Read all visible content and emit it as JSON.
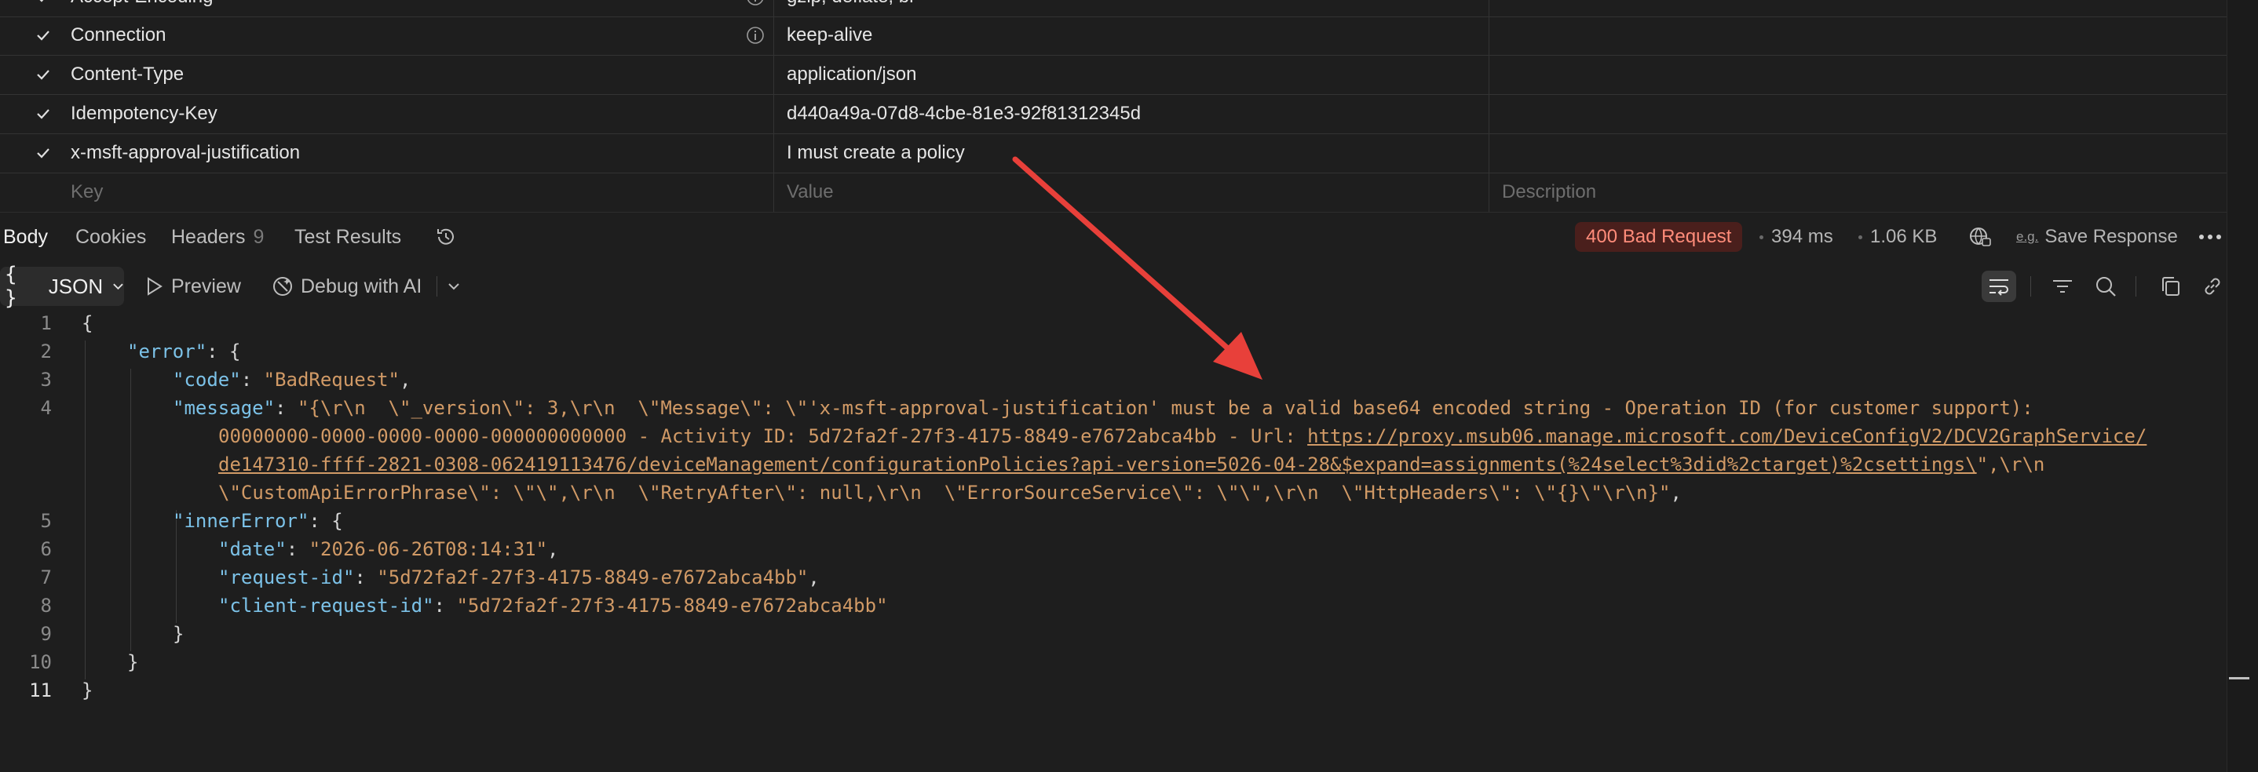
{
  "headers_table": {
    "rows": [
      {
        "key": "Accept-Encoding",
        "value": "gzip, deflate, br",
        "has_info": true
      },
      {
        "key": "Connection",
        "value": "keep-alive",
        "has_info": true
      },
      {
        "key": "Content-Type",
        "value": "application/json",
        "has_info": false
      },
      {
        "key": "Idempotency-Key",
        "value": "d440a49a-07d8-4cbe-81e3-92f81312345d",
        "has_info": false
      },
      {
        "key": "x-msft-approval-justification",
        "value": "I must create a policy",
        "has_info": false
      }
    ],
    "placeholder": {
      "key": "Key",
      "value": "Value",
      "description": "Description"
    }
  },
  "response_tabs": {
    "body": "Body",
    "cookies": "Cookies",
    "headers": "Headers",
    "headers_count": "9",
    "test_results": "Test Results"
  },
  "response_meta": {
    "status": "400 Bad Request",
    "status_color": "#ff8c7a",
    "time": "394 ms",
    "size": "1.06 KB",
    "save_label": "Save Response",
    "save_icon_text": "e.g."
  },
  "toolbar": {
    "format_icon": "{ }",
    "format": "JSON",
    "preview": "Preview",
    "debug": "Debug with AI"
  },
  "code": {
    "line_numbers": [
      "1",
      "2",
      "3",
      "4",
      "",
      "",
      "",
      "5",
      "6",
      "7",
      "8",
      "9",
      "10",
      "11"
    ],
    "l1": "{",
    "l2_key": "\"error\"",
    "l2_rest": ": {",
    "l3_key": "\"code\"",
    "l3_sep": ": ",
    "l3_val": "\"BadRequest\"",
    "l3_end": ",",
    "l4_key": "\"message\"",
    "l4_sep": ": ",
    "l4_val_a": "\"{\\r\\n  \\\"_version\\\": 3,\\r\\n  \\\"Message\\\": \\\"'x-msft-approval-justification' must be a valid base64 encoded string - Operation ID (for customer support):",
    "l4_val_b": "00000000-0000-0000-0000-000000000000 - Activity ID: 5d72fa2f-27f3-4175-8849-e7672abca4bb - Url: ",
    "l4_url_1": "https://proxy.msub06.manage.microsoft.com/DeviceConfigV2/DCV2GraphService/",
    "l4_url_2": "de147310-ffff-2821-0308-062419113476/deviceManagement/configurationPolicies?api-version=5026-04-28&$expand=assignments(%24select%3did%2ctarget)%2csettings\\",
    "l4_val_c": "\",\\r\\n",
    "l4_val_d": "\\\"CustomApiErrorPhrase\\\": \\\"\\\",\\r\\n  \\\"RetryAfter\\\": null,\\r\\n  \\\"ErrorSourceService\\\": \\\"\\\",\\r\\n  \\\"HttpHeaders\\\": \\\"{}\\\"\\r\\n}\"",
    "l4_end": ",",
    "l5_key": "\"innerError\"",
    "l5_rest": ": {",
    "l6_key": "\"date\"",
    "l6_val": "\"2026-06-26T08:14:31\"",
    "l7_key": "\"request-id\"",
    "l7_val": "\"5d72fa2f-27f3-4175-8849-e7672abca4bb\"",
    "l8_key": "\"client-request-id\"",
    "l8_val": "\"5d72fa2f-27f3-4175-8849-e7672abca4bb\"",
    "l9": "}",
    "l10": "}",
    "l11": "}",
    "sep": ": ",
    "comma": ","
  },
  "annotation": {
    "arrow_color": "#e8403a"
  },
  "colors": {
    "key": "#7cc2e8",
    "string": "#d19a66",
    "background": "#1e1e1e"
  }
}
